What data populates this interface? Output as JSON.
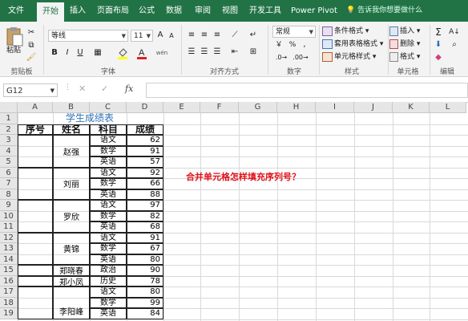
{
  "ribbon": {
    "tabs": [
      "文件",
      "开始",
      "插入",
      "页面布局",
      "公式",
      "数据",
      "审阅",
      "视图",
      "开发工具",
      "Power Pivot"
    ],
    "active_tab": "开始",
    "tell_me": "告诉我你想要做什么",
    "clipboard": {
      "paste": "粘贴",
      "group": "剪贴板"
    },
    "font": {
      "name": "等线",
      "size": "11",
      "bold": "B",
      "italic": "I",
      "underline": "U",
      "grow": "A",
      "shrink": "A",
      "wen": "wén",
      "group": "字体"
    },
    "alignment": {
      "group": "对齐方式"
    },
    "number": {
      "format": "常规",
      "group": "数字",
      "percent": "%",
      "comma": ",",
      "currency": "￥"
    },
    "styles": {
      "conditional": "条件格式",
      "table": "套用表格格式",
      "cell": "单元格样式",
      "group": "样式"
    },
    "cells": {
      "insert": "插入",
      "delete": "删除",
      "format": "格式",
      "group": "单元格"
    },
    "editing": {
      "group": "编辑"
    }
  },
  "formula_bar": {
    "name_box": "G12",
    "fx": "fx",
    "cancel": "✕",
    "enter": "✓",
    "value": ""
  },
  "grid": {
    "columns": [
      "A",
      "B",
      "C",
      "D",
      "E",
      "F",
      "G",
      "H",
      "I",
      "J",
      "K",
      "L"
    ],
    "rows": [
      "1",
      "2",
      "3",
      "4",
      "5",
      "6",
      "7",
      "8",
      "9",
      "10",
      "11",
      "12",
      "13",
      "14",
      "15",
      "16",
      "17",
      "18",
      "19"
    ],
    "title": "学生成绩表",
    "headers": [
      "序号",
      "姓名",
      "科目",
      "成绩"
    ],
    "names": [
      "赵强",
      "刘丽",
      "罗欣",
      "黄锦",
      "郑晓春",
      "郑小凤",
      "李阳峰"
    ],
    "subjects": [
      "语文",
      "数学",
      "英语",
      "语文",
      "数学",
      "英语",
      "语文",
      "数学",
      "英语",
      "语文",
      "数学",
      "英语",
      "政治",
      "历史",
      "语文",
      "数学",
      "英语"
    ],
    "scores": [
      "62",
      "91",
      "57",
      "92",
      "66",
      "88",
      "97",
      "82",
      "68",
      "91",
      "67",
      "80",
      "90",
      "78",
      "80",
      "99",
      "84"
    ],
    "note": "合并单元格怎样填充序列号？"
  },
  "colors": {
    "excel_green": "#217346",
    "title_blue": "#2e74b5",
    "note_red": "#e0101a"
  }
}
